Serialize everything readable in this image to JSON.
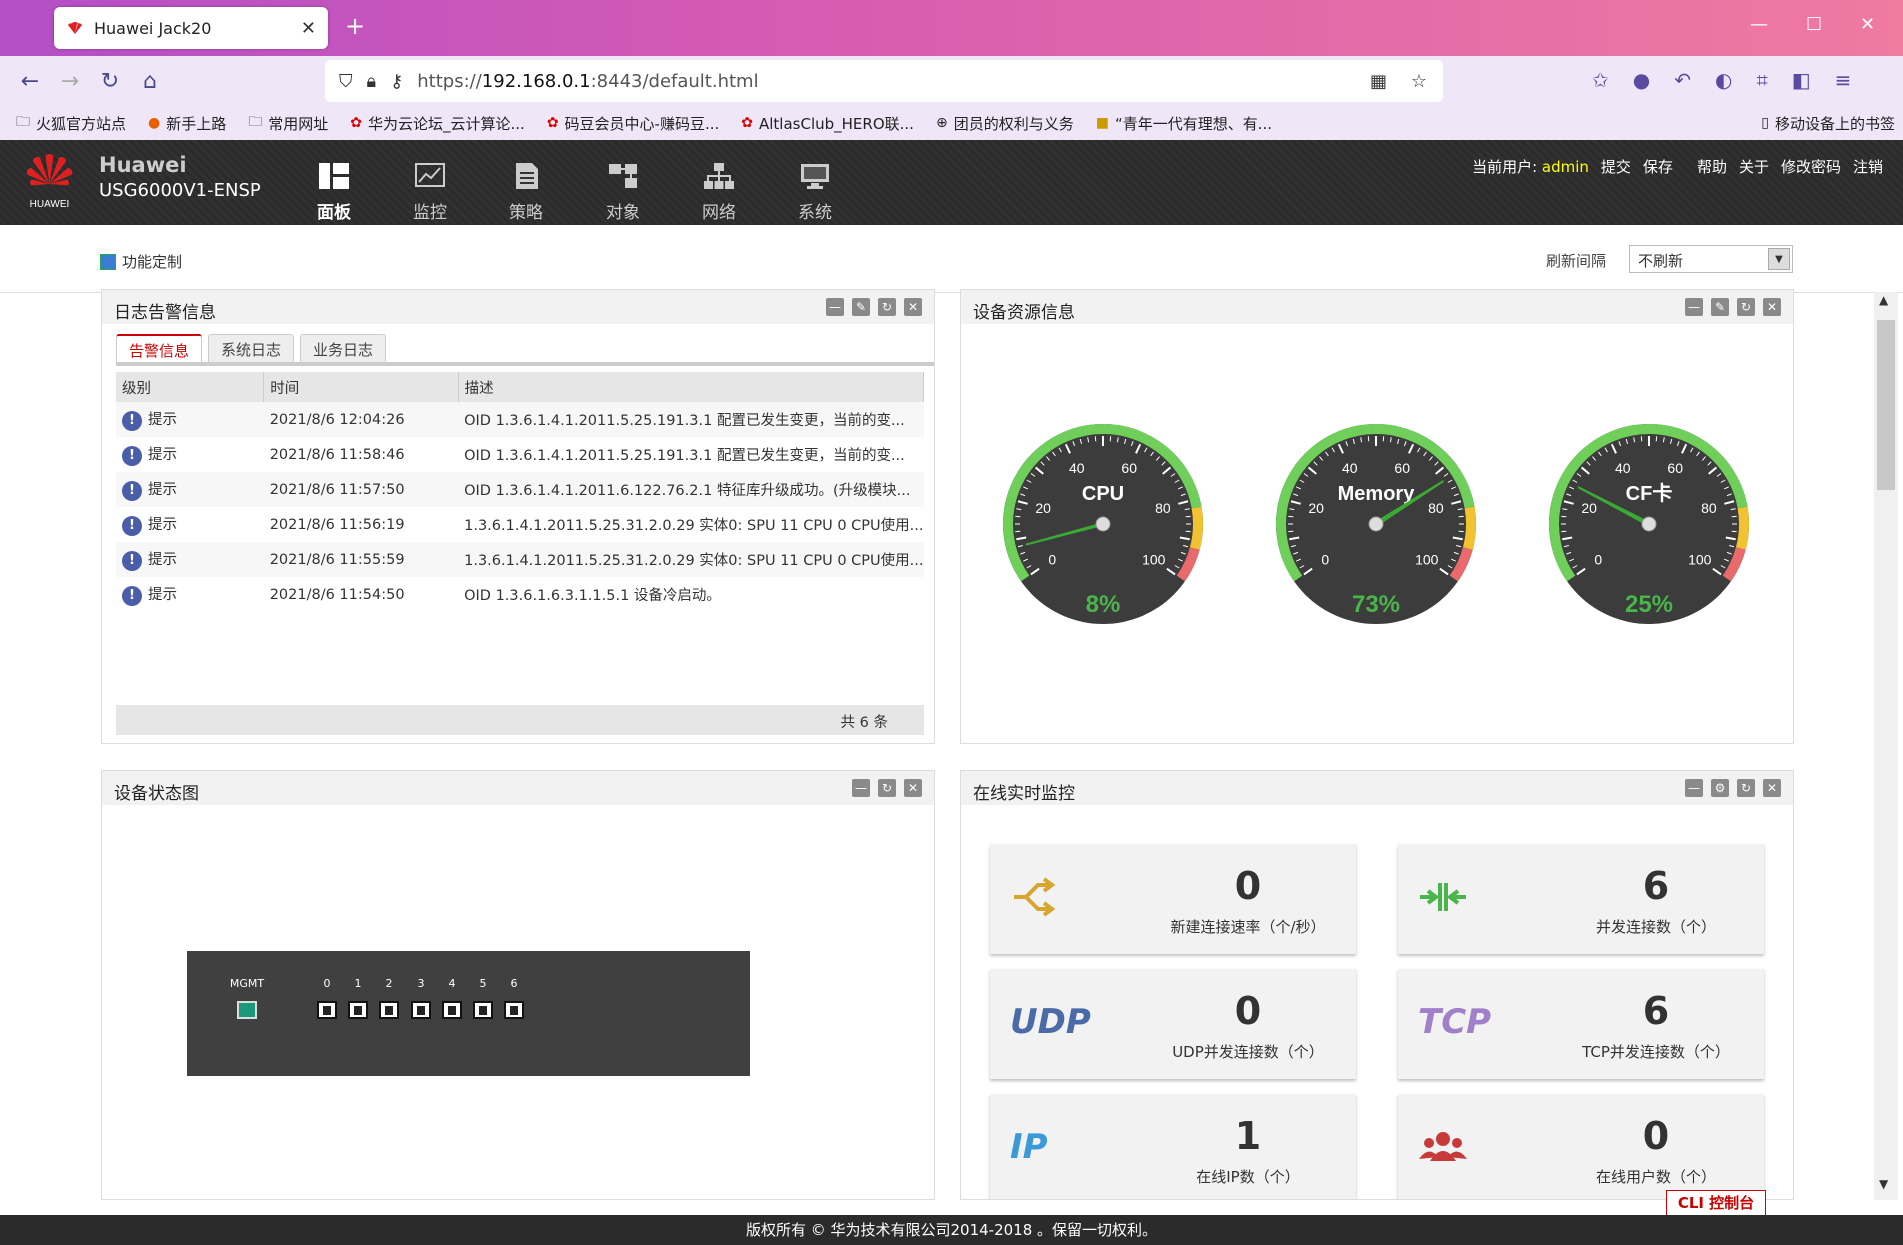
{
  "browser": {
    "tab_title": "Huawei Jack20",
    "url_scheme": "https://",
    "url_host": "192.168.0.1",
    "url_rest": ":8443/default.html",
    "bookmarks": [
      "火狐官方站点",
      "新手上路",
      "常用网址",
      "华为云论坛_云计算论...",
      "码豆会员中心-赚码豆...",
      "AltlasClub_HERO联...",
      "团员的权利与义务",
      "“青年一代有理想、有..."
    ],
    "mobile_bookmarks": "移动设备上的书签"
  },
  "app": {
    "brand_name": "Huawei",
    "model": "USG6000V1-ENSP",
    "logo_text": "HUAWEI",
    "menu": [
      "面板",
      "监控",
      "策略",
      "对象",
      "网络",
      "系统"
    ],
    "user_label": "当前用户:",
    "user": "admin",
    "links": [
      "提交",
      "保存",
      "帮助",
      "关于",
      "修改密码",
      "注销"
    ]
  },
  "toolbar": {
    "custom": "功能定制",
    "refresh_label": "刷新间隔",
    "refresh_value": "不刷新"
  },
  "log_panel": {
    "title": "日志告警信息",
    "tabs": [
      "告警信息",
      "系统日志",
      "业务日志"
    ],
    "columns": [
      "级别",
      "时间",
      "描述"
    ],
    "rows": [
      {
        "level": "提示",
        "time": "2021/8/6 12:04:26",
        "desc": "OID 1.3.6.1.4.1.2011.5.25.191.3.1 配置已发生变更，当前的变..."
      },
      {
        "level": "提示",
        "time": "2021/8/6 11:58:46",
        "desc": "OID 1.3.6.1.4.1.2011.5.25.191.3.1 配置已发生变更，当前的变..."
      },
      {
        "level": "提示",
        "time": "2021/8/6 11:57:50",
        "desc": "OID 1.3.6.1.4.1.2011.6.122.76.2.1 特征库升级成功。(升级模块..."
      },
      {
        "level": "提示",
        "time": "2021/8/6 11:56:19",
        "desc": "1.3.6.1.4.1.2011.5.25.31.2.0.29 实体0: SPU 11 CPU 0 CPU使用..."
      },
      {
        "level": "提示",
        "time": "2021/8/6 11:55:59",
        "desc": "1.3.6.1.4.1.2011.5.25.31.2.0.29 实体0: SPU 11 CPU 0 CPU使用..."
      },
      {
        "level": "提示",
        "time": "2021/8/6 11:54:50",
        "desc": "OID 1.3.6.1.6.3.1.1.5.1 设备冷启动。"
      }
    ],
    "total": "共 6 条"
  },
  "resource_panel": {
    "title": "设备资源信息",
    "tick_labels": [
      "0",
      "20",
      "40",
      "60",
      "80",
      "100"
    ],
    "gauges": [
      {
        "name": "CPU",
        "value": 8,
        "label": "8%"
      },
      {
        "name": "Memory",
        "value": 73,
        "label": "73%"
      },
      {
        "name": "CF卡",
        "value": 25,
        "label": "25%"
      }
    ]
  },
  "device_panel": {
    "title": "设备状态图",
    "mgmt_label": "MGMT",
    "ports": [
      "0",
      "1",
      "2",
      "3",
      "4",
      "5",
      "6"
    ]
  },
  "monitor_panel": {
    "title": "在线实时监控",
    "cards": [
      {
        "icon": "shuffle-icon",
        "value": "0",
        "label": "新建连接速率（个/秒）"
      },
      {
        "icon": "concurrent-icon",
        "value": "6",
        "label": "并发连接数（个）"
      },
      {
        "icon": "udp-icon",
        "icon_text": "UDP",
        "value": "0",
        "label": "UDP并发连接数（个）"
      },
      {
        "icon": "tcp-icon",
        "icon_text": "TCP",
        "value": "6",
        "label": "TCP并发连接数（个）"
      },
      {
        "icon": "ip-icon",
        "icon_text": "IP",
        "value": "1",
        "label": "在线IP数（个）"
      },
      {
        "icon": "users-icon",
        "value": "0",
        "label": "在线用户数（个）"
      }
    ]
  },
  "footer": "版权所有 © 华为技术有限公司2014-2018 。保留一切权利。",
  "cli": "CLI 控制台",
  "colors": {
    "accent_red": "#cc0000",
    "gauge_green": "#3aaa35",
    "header_dark": "#2b2b2b"
  }
}
